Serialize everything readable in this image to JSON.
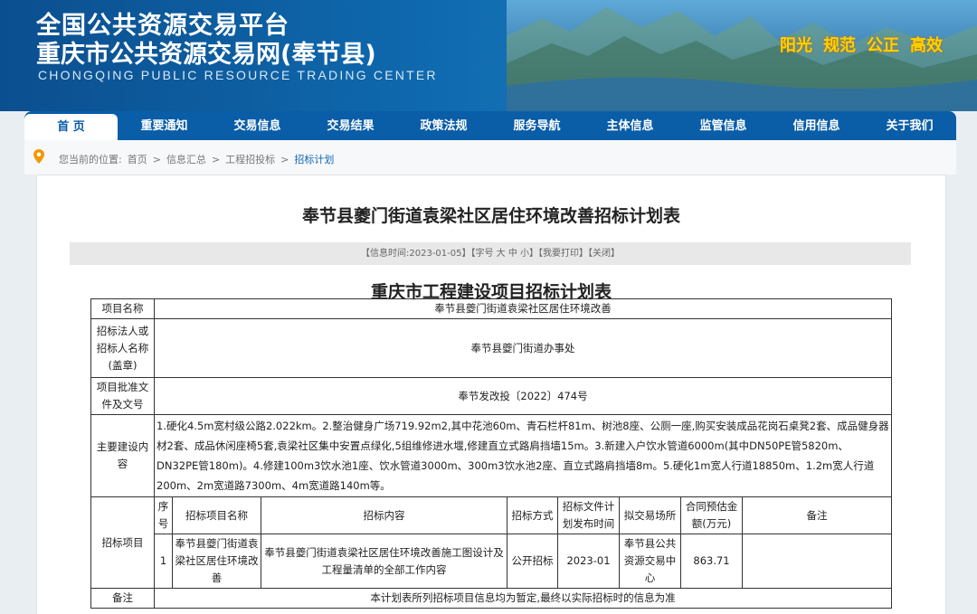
{
  "header": {
    "title_line1": "全国公共资源交易平台",
    "title_line2": "重庆市公共资源交易网(奉节县)",
    "subtitle_en": "CHONGQING PUBLIC RESOURCE TRADING CENTER",
    "slogans": [
      "阳光",
      "规范",
      "公正",
      "高效"
    ],
    "slogan_color": "#ffd200"
  },
  "nav": {
    "items": [
      "首 页",
      "重要通知",
      "交易信息",
      "交易结果",
      "政策法规",
      "服务导航",
      "主体信息",
      "监管信息",
      "信用信息",
      "关于我们"
    ],
    "active_index": 0,
    "color": "#0a5da7"
  },
  "breadcrumb": {
    "prefix": "您当前的位置:",
    "items": [
      "首页",
      "信息汇总",
      "工程招投标",
      "招标计划"
    ],
    "separator": ">",
    "icon": "location-pin-icon"
  },
  "article": {
    "title": "奉节县夔门街道袁梁社区居住环境改善招标计划表",
    "info_bar": "【信息时间:2023-01-05】【字号 大 中 小】【我要打印】【关闭】",
    "table_title": "重庆市工程建设项目招标计划表"
  },
  "plan_table": {
    "project_name_label": "项目名称",
    "project_name": "奉节县夔门街道袁梁社区居住环境改善",
    "tenderer_label": "招标法人或招标人名称(盖章)",
    "tenderer": "奉节县夔门街道办事处",
    "approval_label": "项目批准文件及文号",
    "approval": "奉节发改投〔2022〕474号",
    "scope_label": "主要建设内容",
    "scope": "1.硬化4.5m宽村级公路2.022km。2.整治健身广场719.92m2,其中花池60m、青石栏杆81m、树池8座、公厕一座,购买安装成品花岗石桌凳2套、成品健身器材2套、成品休闲座椅5套,袁梁社区集中安置点绿化,5组维修进水堰,修建直立式路肩挡墙15m。3.新建入户饮水管道6000m(其中DN50PE管5820m、DN32PE管180m)。4.修建100m3饮水池1座、饮水管道3000m、300m3饮水池2座、直立式路肩挡墙8m。5.硬化1m宽人行道18850m、1.2m宽人行道200m、2m宽道路7300m、4m宽道路140m等。",
    "items_label": "招标项目",
    "headers": [
      "序号",
      "招标项目名称",
      "招标内容",
      "招标方式",
      "招标文件计划发布时间",
      "拟交易场所",
      "合同预估金额(万元)",
      "备注"
    ],
    "row": {
      "seq": "1",
      "name": "奉节县夔门街道袁梁社区居住环境改善",
      "content": "奉节县夔门街道袁梁社区居住环境改善施工图设计及工程量清单的全部工作内容",
      "method": "公开招标",
      "publish_time": "2023-01",
      "venue": "奉节县公共资源交易中心",
      "amount": "863.71",
      "remark": ""
    },
    "remark_label": "备注",
    "remark": "本计划表所列招标项目信息均为暂定,最终以实际招标时的信息为准"
  }
}
